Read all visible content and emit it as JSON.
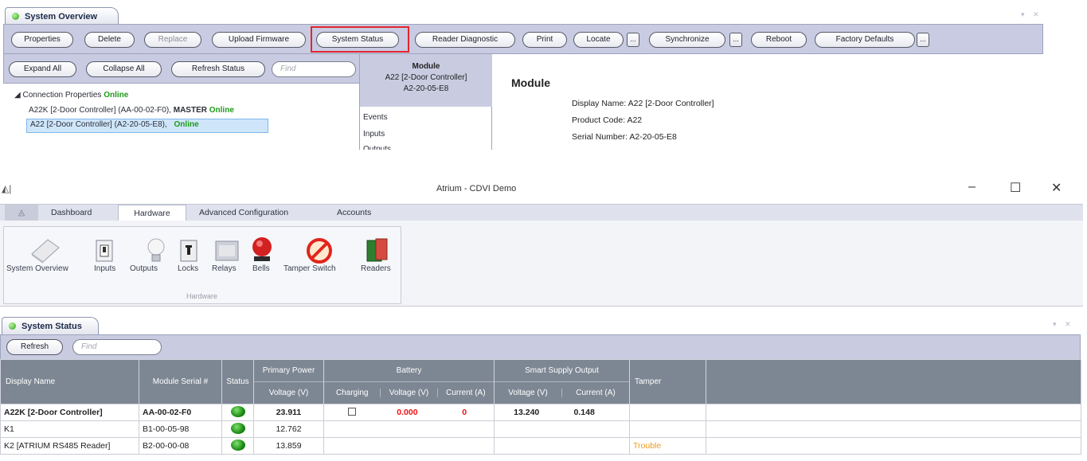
{
  "overview": {
    "tab_label": "System Overview",
    "toolbar": {
      "properties": "Properties",
      "delete": "Delete",
      "replace": "Replace",
      "upload_firmware": "Upload Firmware",
      "system_status": "System Status",
      "reader_diagnostic": "Reader Diagnostic",
      "print": "Print",
      "locate": "Locate",
      "synchronize": "Synchronize",
      "reboot": "Reboot",
      "factory_defaults": "Factory Defaults",
      "more": "..."
    },
    "tree_toolbar": {
      "expand_all": "Expand All",
      "collapse_all": "Collapse All",
      "refresh_status": "Refresh Status",
      "find_placeholder": "Find"
    },
    "tree": {
      "root_label": "Connection Properties",
      "root_status": "Online",
      "node1_label": "A22K [2-Door Controller] (AA-00-02-F0),",
      "node1_master": "MASTER",
      "node1_status": "Online",
      "node2_label": "A22 [2-Door Controller] (A2-20-05-E8),",
      "node2_status": "Online"
    },
    "module_box": {
      "title": "Module",
      "line1": "A22 [2-Door Controller]",
      "line2": "A2-20-05-E8"
    },
    "side_nav": [
      "Events",
      "Inputs",
      "Outputs"
    ],
    "module_details": {
      "heading": "Module",
      "display_name": "Display Name: A22 [2-Door Controller]",
      "product_code": "Product Code: A22",
      "serial_number": "Serial Number: A2-20-05-E8"
    }
  },
  "window": {
    "title": "Atrium - CDVI Demo",
    "minimize": "–",
    "maximize": "☐",
    "close": "✕"
  },
  "ribbon": {
    "tabs": [
      "Dashboard",
      "Hardware",
      "Advanced Configuration",
      "Accounts"
    ],
    "active_tab": "Hardware",
    "group_label": "Hardware",
    "buttons": [
      "System Overview",
      "Inputs",
      "Outputs",
      "Locks",
      "Relays",
      "Bells",
      "Tamper Switch",
      "Readers"
    ]
  },
  "status_panel": {
    "tab_label": "System Status",
    "refresh": "Refresh",
    "find_placeholder": "Find",
    "headers": {
      "display_name": "Display Name",
      "module_serial": "Module Serial #",
      "status": "Status",
      "primary_power": "Primary Power",
      "primary_voltage": "Voltage (V)",
      "battery": "Battery",
      "charging": "Charging",
      "battery_voltage": "Voltage (V)",
      "battery_current": "Current (A)",
      "smart_supply": "Smart Supply Output",
      "smart_voltage": "Voltage (V)",
      "smart_current": "Current (A)",
      "tamper": "Tamper"
    },
    "rows": [
      {
        "name": "A22K [2-Door Controller]",
        "serial": "AA-00-02-F0",
        "primary_voltage": "23.911",
        "battery_voltage": "0.000",
        "battery_current": "0",
        "smart_voltage": "13.240",
        "smart_current": "0.148",
        "tamper": ""
      },
      {
        "name": "K1",
        "serial": "B1-00-05-98",
        "primary_voltage": "12.762",
        "battery_voltage": "",
        "battery_current": "",
        "smart_voltage": "",
        "smart_current": "",
        "tamper": ""
      },
      {
        "name": "K2 [ATRIUM RS485 Reader]",
        "serial": "B2-00-00-08",
        "primary_voltage": "13.859",
        "battery_voltage": "",
        "battery_current": "",
        "smart_voltage": "",
        "smart_current": "",
        "tamper": "Trouble"
      }
    ]
  },
  "colors": {
    "toolbar_bg": "#c8cbe1",
    "header_bg": "#7d8793",
    "online_green": "#1f9a1a",
    "highlight_red": "#e3262f",
    "value_red": "#ee1111",
    "trouble_orange": "#f09a16"
  }
}
